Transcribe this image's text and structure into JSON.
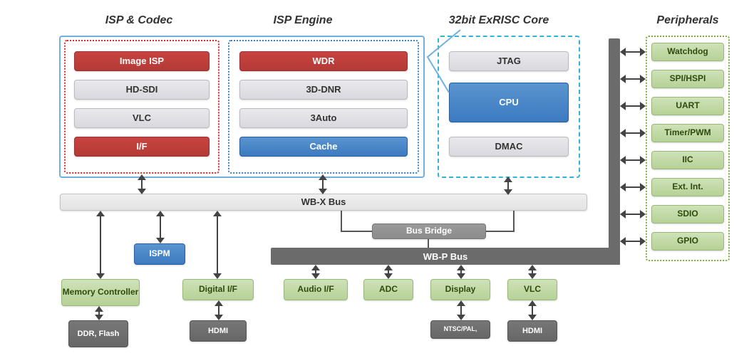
{
  "headings": {
    "codec": "ISP & Codec",
    "engine": "ISP Engine",
    "core": "32bit ExRISC Core",
    "periph": "Peripherals"
  },
  "codec": {
    "image_isp": "Image ISP",
    "hd_sdi": "HD-SDI",
    "vlc": "VLC",
    "if": "I/F"
  },
  "engine": {
    "wdr": "WDR",
    "dnr": "3D-DNR",
    "auto": "3Auto",
    "cache": "Cache"
  },
  "core": {
    "jtag": "JTAG",
    "cpu": "CPU",
    "dmac": "DMAC"
  },
  "periph": {
    "watchdog": "Watchdog",
    "spi": "SPI/HSPI",
    "uart": "UART",
    "timer": "Timer/PWM",
    "iic": "IIC",
    "ext": "Ext. Int.",
    "sdio": "SDIO",
    "gpio": "GPIO"
  },
  "buses": {
    "wbx": "WB-X Bus",
    "bridge": "Bus Bridge",
    "wbp": "WB-P Bus"
  },
  "bottom": {
    "ispm": "ISPM",
    "memctrl": "Memory Controller",
    "digital_if": "Digital I/F",
    "audio_if": "Audio I/F",
    "adc": "ADC",
    "display": "Display",
    "vlc": "VLC",
    "ddr": "DDR, Flash",
    "hdmi1": "HDMI",
    "ntsc": "NTSC/PAL,",
    "hdmi2": "HDMI"
  }
}
